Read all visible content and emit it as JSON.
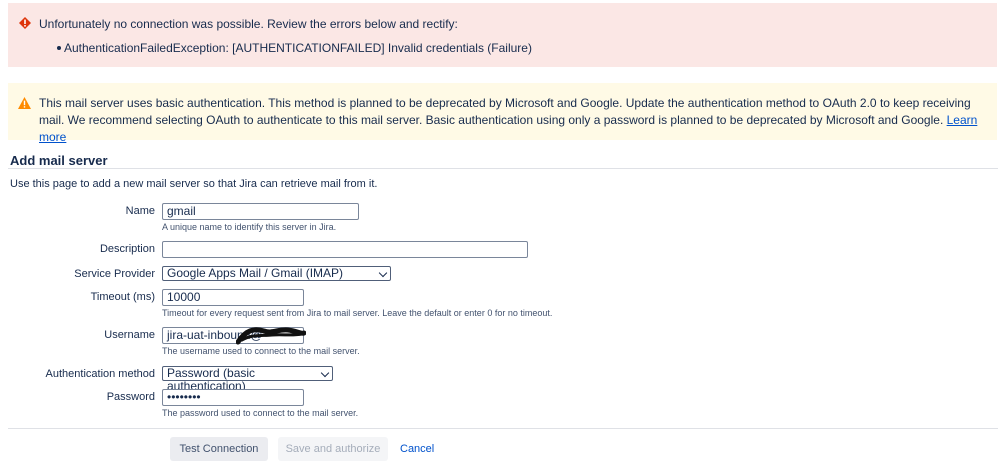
{
  "error": {
    "title": "Unfortunately no connection was possible. Review the errors below and rectify:",
    "items": [
      "AuthenticationFailedException: [AUTHENTICATIONFAILED] Invalid credentials (Failure)"
    ],
    "icon": "error-icon",
    "color": "#de350b"
  },
  "warning": {
    "text": "This mail server uses basic authentication. This method is planned to be deprecated by Microsoft and Google. Update the authentication method to OAuth 2.0 to keep receiving mail. We recommend selecting OAuth to authenticate to this mail server. Basic authentication using only a password is planned to be deprecated by Microsoft and Google.",
    "link": "Learn more",
    "icon": "warning-icon",
    "color": "#ff8b00"
  },
  "page": {
    "title": "Add mail server",
    "description": "Use this page to add a new mail server so that Jira can retrieve mail from it."
  },
  "form": {
    "name": {
      "label": "Name",
      "value": "gmail",
      "hint": "A unique name to identify this server in Jira."
    },
    "description": {
      "label": "Description",
      "value": ""
    },
    "service_provider": {
      "label": "Service Provider",
      "value": "Google Apps Mail / Gmail (IMAP)"
    },
    "timeout": {
      "label": "Timeout (ms)",
      "value": "10000",
      "hint": "Timeout for every request sent from Jira to mail server. Leave the default or enter 0 for no timeout."
    },
    "username": {
      "label": "Username",
      "value": "jira-uat-inbound@",
      "hint": "The username used to connect to the mail server."
    },
    "auth_method": {
      "label": "Authentication method",
      "value": "Password (basic authentication)"
    },
    "password": {
      "label": "Password",
      "value": "••••••••",
      "hint": "The password used to connect to the mail server."
    }
  },
  "actions": {
    "test": "Test Connection",
    "save": "Save and authorize",
    "cancel": "Cancel"
  }
}
